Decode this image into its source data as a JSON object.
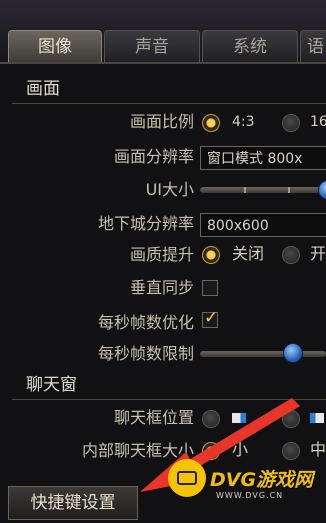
{
  "tabs": [
    {
      "label": "图像",
      "active": true
    },
    {
      "label": "声音",
      "active": false
    },
    {
      "label": "系统",
      "active": false
    },
    {
      "label": "语",
      "active": false
    }
  ],
  "sections": {
    "picture": "画面",
    "chat": "聊天窗"
  },
  "settings": {
    "aspect_ratio": {
      "label": "画面比例",
      "options": [
        "4:3",
        "16"
      ],
      "selected": "4:3"
    },
    "resolution": {
      "label": "画面分辨率",
      "value": "窗口模式 800x"
    },
    "ui_size": {
      "label": "UI大小"
    },
    "dungeon_resolution": {
      "label": "地下城分辨率",
      "value": "800x600"
    },
    "quality_boost": {
      "label": "画质提升",
      "options": [
        "关闭",
        "开"
      ],
      "selected": "关闭"
    },
    "vsync": {
      "label": "垂直同步",
      "checked": false
    },
    "fps_optimize": {
      "label": "每秒帧数优化",
      "checked": true
    },
    "fps_limit": {
      "label": "每秒帧数限制"
    },
    "chat_position": {
      "label": "聊天框位置"
    },
    "inner_chat_size": {
      "label": "内部聊天框大小",
      "options": [
        "小",
        "中"
      ],
      "selected": "小"
    }
  },
  "bottom": {
    "shortcut_button": "快捷键设置"
  },
  "watermark": {
    "brand": "DVG游戏网",
    "url": "WWW.DVG.CN"
  },
  "colors": {
    "accent": "#ffcf55",
    "slider_knob": "#2b62b8",
    "annotation_arrow": "#e8362a",
    "watermark": "#f5c400"
  }
}
